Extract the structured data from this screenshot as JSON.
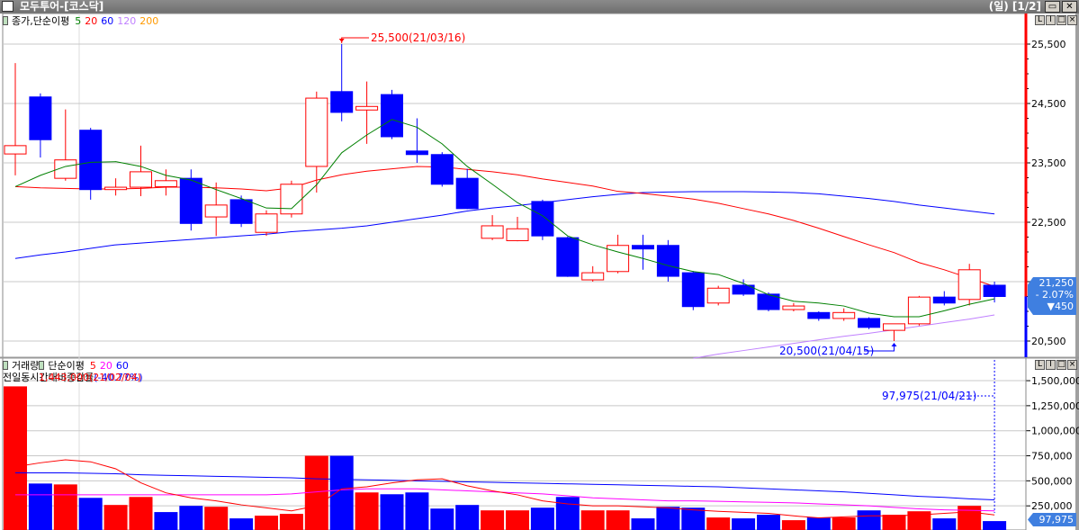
{
  "window": {
    "title": "모두투어-[코스닥]",
    "period": "(일) [1/2]",
    "restore_icon": "restore-icon",
    "close_icon": "close-icon"
  },
  "price_panel": {
    "legend_title": "종가,단순이평",
    "ma_labels": [
      {
        "label": "5",
        "color": "#008000"
      },
      {
        "label": "20",
        "color": "#ff0000"
      },
      {
        "label": "60",
        "color": "#0000ff"
      },
      {
        "label": "120",
        "color": "#c080ff"
      },
      {
        "label": "200",
        "color": "#ff9900"
      }
    ],
    "current": {
      "price": "21,250",
      "change_pct": "- 2.07%",
      "change": "▼450"
    },
    "high_annotation": "25,500(21/03/16)",
    "low_annotation": "20,500(21/04/15)",
    "panel_buttons": [
      "L",
      "I",
      "□",
      "×"
    ]
  },
  "volume_panel": {
    "legend_title": "거래량",
    "legend_ma_title": "단순이평",
    "ma_labels": [
      {
        "label": "5",
        "color": "#ff0000"
      },
      {
        "label": "20",
        "color": "#ff00ff"
      },
      {
        "label": "60",
        "color": "#0000ff"
      }
    ],
    "compare_label": "전일동시간대비증감률",
    "compare_value": "(-40.77%)",
    "max_overlay": "1,443,000(21/02/04)",
    "last_annotation": "97,975(21/04/21)",
    "current_volume": "97,975",
    "panel_buttons": [
      "L",
      "I",
      "□",
      "×"
    ]
  },
  "colors": {
    "up": "#ff0000",
    "down": "#0000ff",
    "grid": "#c8c8c8"
  },
  "chart_data": [
    {
      "type": "candlestick",
      "title": "모두투어-[코스닥] 일봉",
      "yticks": [
        "25,500",
        "24,500",
        "23,500",
        "22,500",
        "21,500",
        "20,500"
      ],
      "ylim": [
        20300,
        25900
      ],
      "ohlc": [
        [
          23650,
          25180,
          23290,
          23790
        ],
        [
          24610,
          24670,
          23590,
          23890
        ],
        [
          23240,
          24400,
          23200,
          23550
        ],
        [
          24050,
          24090,
          22880,
          23050
        ],
        [
          23050,
          23240,
          22950,
          23090
        ],
        [
          23090,
          23790,
          22940,
          23350
        ],
        [
          23100,
          23390,
          22950,
          23200
        ],
        [
          23240,
          23390,
          22360,
          22480
        ],
        [
          22590,
          23170,
          22270,
          22790
        ],
        [
          22880,
          22950,
          22420,
          22480
        ],
        [
          22330,
          22700,
          22270,
          22640
        ],
        [
          22640,
          23200,
          22580,
          23140
        ],
        [
          23440,
          24700,
          23000,
          24590
        ],
        [
          24700,
          25500,
          24200,
          24350
        ],
        [
          24390,
          24870,
          23820,
          24450
        ],
        [
          24650,
          24730,
          23900,
          23940
        ],
        [
          23700,
          24250,
          23500,
          23640
        ],
        [
          23640,
          23680,
          23100,
          23140
        ],
        [
          23240,
          23400,
          22720,
          22730
        ],
        [
          22230,
          22620,
          22200,
          22440
        ],
        [
          22190,
          22590,
          22180,
          22390
        ],
        [
          22850,
          22880,
          22200,
          22270
        ],
        [
          22240,
          22260,
          21580,
          21590
        ],
        [
          21530,
          21760,
          21500,
          21650
        ],
        [
          21670,
          22290,
          21640,
          22110
        ],
        [
          22110,
          22290,
          21700,
          22050
        ],
        [
          22110,
          22200,
          21500,
          21590
        ],
        [
          21650,
          21680,
          21020,
          21080
        ],
        [
          21140,
          21430,
          21100,
          21390
        ],
        [
          21440,
          21540,
          21260,
          21290
        ],
        [
          21290,
          21320,
          21000,
          21030
        ],
        [
          21030,
          21140,
          21000,
          21090
        ],
        [
          20980,
          21000,
          20840,
          20880
        ],
        [
          20880,
          21050,
          20840,
          20980
        ],
        [
          20880,
          20900,
          20700,
          20730
        ],
        [
          20680,
          20790,
          20500,
          20790
        ],
        [
          20790,
          21260,
          20760,
          21240
        ],
        [
          21240,
          21340,
          21100,
          21140
        ],
        [
          21200,
          21800,
          21100,
          21700
        ],
        [
          21440,
          21500,
          21150,
          21250
        ]
      ],
      "ma5": [
        23100,
        23290,
        23440,
        23510,
        23520,
        23440,
        23290,
        23210,
        23050,
        22900,
        22740,
        22730,
        23130,
        23670,
        23970,
        24230,
        24100,
        23820,
        23440,
        23140,
        22830,
        22610,
        22270,
        22120,
        22000,
        21890,
        21770,
        21670,
        21620,
        21470,
        21280,
        21170,
        21140,
        21090,
        20970,
        20910,
        20910,
        21010,
        21120,
        21210
      ],
      "ma20": [
        23100,
        23080,
        23070,
        23060,
        23060,
        23070,
        23090,
        23090,
        23080,
        23060,
        23030,
        23080,
        23210,
        23300,
        23360,
        23400,
        23440,
        23430,
        23390,
        23350,
        23300,
        23230,
        23170,
        23110,
        23020,
        22985,
        22940,
        22890,
        22820,
        22730,
        22640,
        22530,
        22400,
        22260,
        22120,
        21990,
        21820,
        21700,
        21560,
        21420
      ],
      "ma60": [
        21890,
        21950,
        22000,
        22060,
        22120,
        22150,
        22180,
        22210,
        22240,
        22270,
        22300,
        22340,
        22370,
        22400,
        22440,
        22500,
        22560,
        22620,
        22690,
        22740,
        22780,
        22830,
        22880,
        22930,
        22970,
        23000,
        23010,
        23015,
        23015,
        23015,
        23010,
        23000,
        22980,
        22940,
        22900,
        22850,
        22790,
        22740,
        22690,
        22640
      ],
      "ma120": [
        null,
        null,
        null,
        null,
        null,
        null,
        null,
        null,
        null,
        null,
        null,
        null,
        null,
        null,
        null,
        null,
        null,
        null,
        null,
        null,
        null,
        null,
        null,
        null,
        null,
        null,
        null,
        20210,
        20280,
        20340,
        20400,
        20460,
        20520,
        20580,
        20630,
        20690,
        20750,
        20810,
        20870,
        20940
      ]
    },
    {
      "type": "bar",
      "title": "거래량",
      "yticks": [
        "1,500,000",
        "1,250,000",
        "1,000,000",
        "750,000",
        "500,000",
        "250,000"
      ],
      "ylim": [
        0,
        1500000
      ],
      "values": [
        1443000,
        473000,
        464000,
        330000,
        259000,
        339000,
        188000,
        250000,
        241000,
        125000,
        152000,
        170000,
        750000,
        750000,
        384000,
        366000,
        384000,
        223000,
        259000,
        205000,
        205000,
        232000,
        339000,
        205000,
        205000,
        125000,
        241000,
        232000,
        134000,
        125000,
        161000,
        107000,
        134000,
        134000,
        205000,
        161000,
        196000,
        125000,
        250000,
        97975
      ],
      "up": [
        1,
        0,
        1,
        0,
        1,
        1,
        0,
        0,
        1,
        0,
        1,
        1,
        1,
        0,
        1,
        0,
        0,
        0,
        0,
        1,
        1,
        0,
        0,
        1,
        1,
        0,
        0,
        0,
        1,
        0,
        0,
        1,
        0,
        1,
        0,
        1,
        1,
        0,
        1,
        0
      ],
      "ma5": [
        640000,
        680000,
        710000,
        690000,
        620000,
        480000,
        380000,
        330000,
        300000,
        260000,
        230000,
        200000,
        250000,
        420000,
        440000,
        480000,
        510000,
        520000,
        450000,
        400000,
        360000,
        300000,
        270000,
        250000,
        250000,
        240000,
        230000,
        210000,
        195000,
        185000,
        175000,
        150000,
        130000,
        140000,
        150000,
        150000,
        160000,
        175000,
        190000,
        160000
      ],
      "ma20": [
        360000,
        360000,
        360000,
        360000,
        360000,
        360000,
        360000,
        360000,
        360000,
        360000,
        360000,
        370000,
        390000,
        410000,
        420000,
        420000,
        420000,
        410000,
        400000,
        390000,
        380000,
        370000,
        350000,
        330000,
        320000,
        310000,
        300000,
        300000,
        295000,
        290000,
        285000,
        280000,
        270000,
        260000,
        250000,
        235000,
        220000,
        210000,
        205000,
        200000
      ],
      "ma60": [
        580000,
        580000,
        580000,
        575000,
        570000,
        560000,
        555000,
        550000,
        545000,
        540000,
        535000,
        530000,
        520000,
        515000,
        510000,
        505000,
        500000,
        495000,
        490000,
        485000,
        480000,
        475000,
        470000,
        465000,
        460000,
        455000,
        450000,
        445000,
        440000,
        430000,
        420000,
        410000,
        400000,
        390000,
        375000,
        360000,
        345000,
        335000,
        320000,
        310000
      ]
    }
  ]
}
